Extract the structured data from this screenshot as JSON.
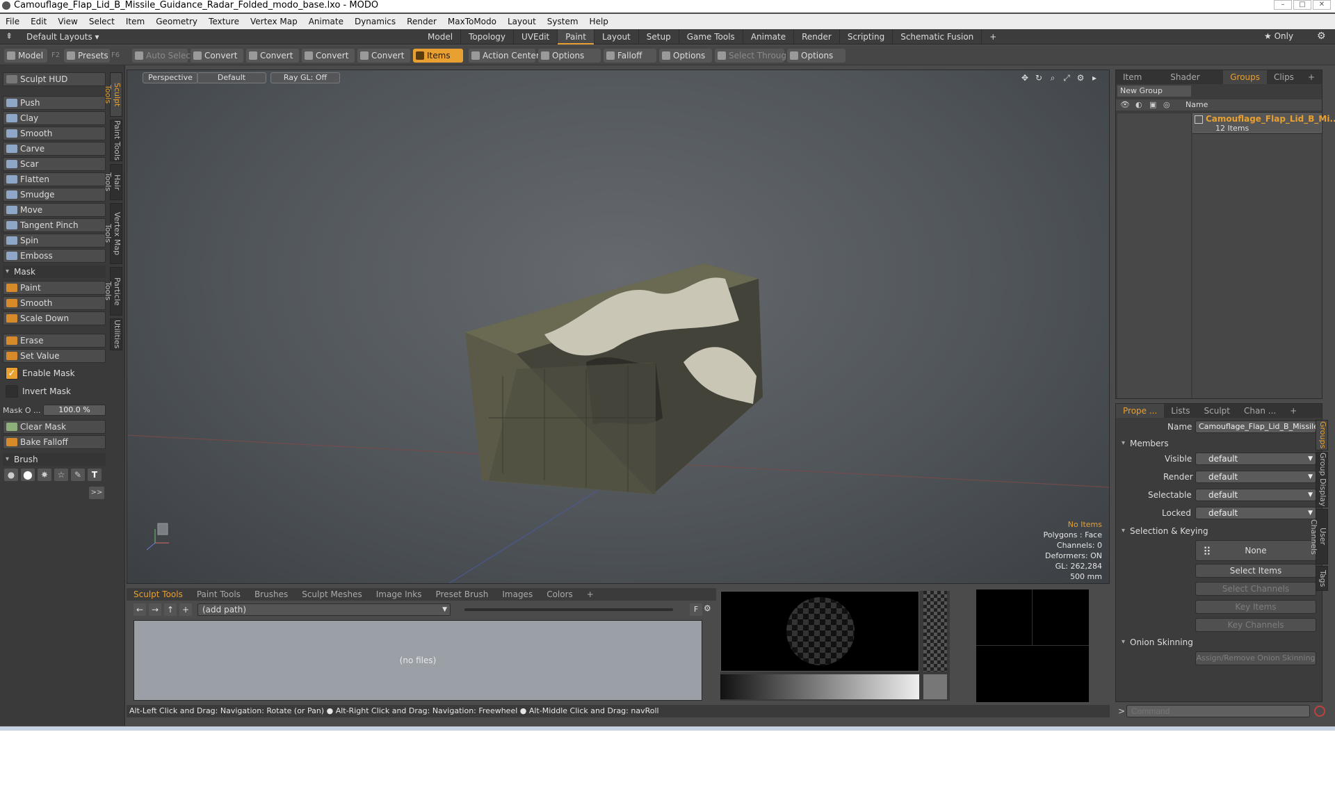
{
  "window": {
    "title": "Camouflage_Flap_Lid_B_Missile_Guidance_Radar_Folded_modo_base.lxo - MODO"
  },
  "menu": [
    "File",
    "Edit",
    "View",
    "Select",
    "Item",
    "Geometry",
    "Texture",
    "Vertex Map",
    "Animate",
    "Dynamics",
    "Render",
    "MaxToModo",
    "Layout",
    "System",
    "Help"
  ],
  "layouts": {
    "default_label": "Default Layouts ▾",
    "tabs": [
      "Model",
      "Topology",
      "UVEdit",
      "Paint",
      "Layout",
      "Setup",
      "Game Tools",
      "Animate",
      "Render",
      "Scripting",
      "Schematic Fusion"
    ],
    "active": "Paint",
    "add": "+",
    "only": "★ Only"
  },
  "toolbar": {
    "model": "Model",
    "model_key": "F2",
    "presets": "Presets",
    "presets_key": "F6",
    "auto_select": "Auto Select",
    "convert": "Convert",
    "items": "Items",
    "action_center": "Action Center",
    "options": "Options",
    "falloff": "Falloff",
    "select_through": "Select Through",
    "accent": "#e8a030"
  },
  "left": {
    "hud": "Sculpt HUD",
    "tools": [
      "Push",
      "Clay",
      "Smooth",
      "Carve",
      "Scar",
      "Flatten",
      "Smudge",
      "Move",
      "Tangent Pinch",
      "Spin",
      "Emboss"
    ],
    "mask_header": "Mask",
    "mask_tools": [
      "Paint",
      "Smooth",
      "Scale Down"
    ],
    "erase": "Erase",
    "set_value": "Set Value",
    "enable_mask": "Enable Mask",
    "invert_mask": "Invert Mask",
    "mask_opacity_label": "Mask O ...",
    "mask_opacity_value": "100.0 %",
    "clear_mask": "Clear Mask",
    "bake_falloff": "Bake Falloff",
    "brush_header": "Brush",
    "more": ">>",
    "vtabs": [
      "Sculpt Tools",
      "Paint Tools",
      "Hair Tools",
      "Vertex Map Tools",
      "Particle Tools",
      "Utilities"
    ]
  },
  "viewport": {
    "buttons": [
      "Perspective",
      "Default",
      "Ray GL: Off"
    ],
    "stats": [
      "No Items",
      "Polygons : Face",
      "Channels: 0",
      "Deformers: ON",
      "GL: 262,284",
      "500 mm"
    ]
  },
  "bottom": {
    "tabs": [
      "Sculpt Tools",
      "Paint Tools",
      "Brushes",
      "Sculpt Meshes",
      "Image Inks",
      "Preset Brush",
      "Images",
      "Colors",
      "+"
    ],
    "path": "(add path)",
    "no_files": "(no files)",
    "f": "F"
  },
  "status": "Alt-Left Click and Drag: Navigation: Rotate (or Pan) ● Alt-Right Click and Drag: Navigation: Freewheel ● Alt-Middle Click and Drag: navRoll",
  "right_top": {
    "tabs": [
      "Item List",
      "Shader Tree",
      "Groups",
      "Clips",
      "+"
    ],
    "active": "Groups",
    "new_group": "New Group",
    "col_name": "Name",
    "group_name": "Camouflage_Flap_Lid_B_Mi...",
    "group_count": "12 Items"
  },
  "right_bottom": {
    "tabs": [
      "Prope ...",
      "Lists",
      "Sculpt",
      "Chan ...",
      "+"
    ],
    "name_label": "Name",
    "name_value": "Camouflage_Flap_Lid_B_Missile_G",
    "members": "Members",
    "visible": "Visible",
    "render": "Render",
    "selectable": "Selectable",
    "locked": "Locked",
    "default": "default",
    "sel_keying": "Selection & Keying",
    "none": "None",
    "select_items": "Select Items",
    "select_channels": "Select Channels",
    "key_items": "Key Items",
    "key_channels": "Key Channels",
    "onion": "Onion Skinning",
    "assign_onion": "Assign/Remove Onion Skinning",
    "vtabs": [
      "Groups",
      "Group Display",
      "User Channels",
      "Tags"
    ]
  },
  "command": {
    "prompt": ">",
    "placeholder": "Command"
  }
}
